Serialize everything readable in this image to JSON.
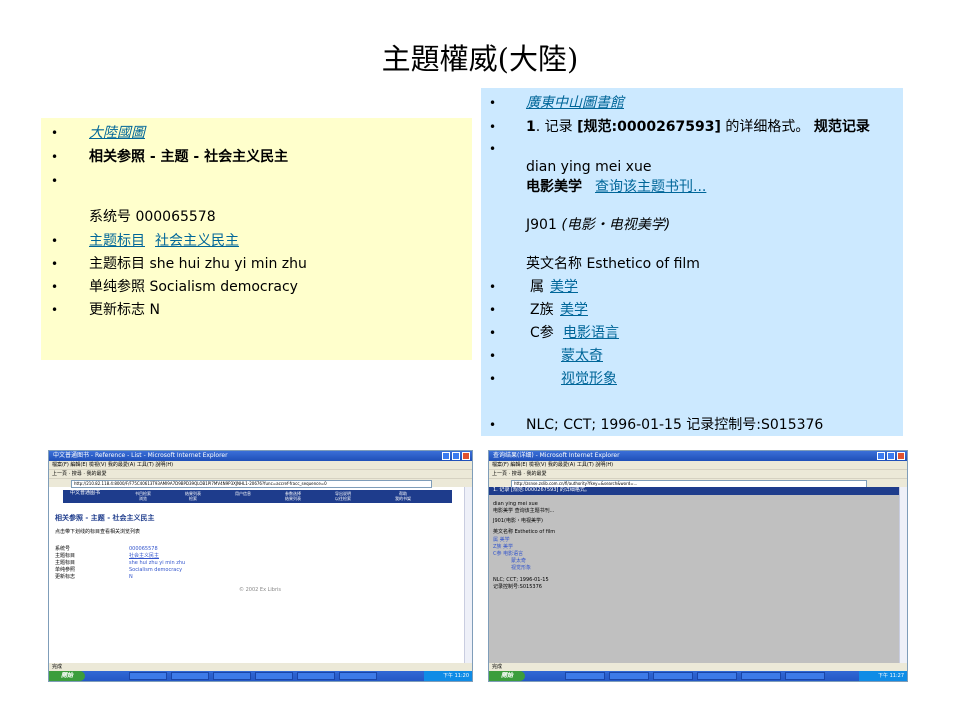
{
  "title": "主題權威(大陸)",
  "left_box": {
    "items": [
      {
        "text": "大陸國圖"
      },
      {
        "text": "相关参照 - 主题 - 社会主义民主"
      },
      {
        "text": ""
      },
      {
        "text": "系统号 000065578"
      },
      {
        "label": "主题标目",
        "link": "社会主义民主"
      },
      {
        "text": "主题标目 she hui zhu yi min zhu"
      },
      {
        "text": "单纯参照 Socialism democracy"
      },
      {
        "text": "更新标志 N"
      }
    ]
  },
  "right_box": {
    "items": [
      {
        "text": "廣東中山圖書館"
      },
      {
        "num": "1",
        "pre": ". 记录 ",
        "id": "[规范:0000267593]",
        "mid": " 的详细格式。 ",
        "tail": "规范记录"
      },
      {
        "text": ""
      },
      {
        "text": "dian ying mei xue"
      },
      {
        "label": "电影美学",
        "link": "查询该主题书刊..."
      },
      {
        "code": "J901",
        "class": "(电影・电视美学)"
      },
      {
        "text": "英文名称 Esthetico of film"
      },
      {
        "label": "属",
        "link": "美学"
      },
      {
        "label": "Z族",
        "link": "美学"
      },
      {
        "label": "C参",
        "link": "电影语言"
      },
      {
        "link": "蒙太奇"
      },
      {
        "link": "视觉形象"
      },
      {
        "text": "NLC; CCT; 1996-01-15 记录控制号:S015376"
      }
    ]
  },
  "screenshot_left": {
    "window_title": "中文普通图书 - Reference - List - Microsoft Internet Explorer",
    "menu": "檔案(F)  編輯(E)  檢視(V)  我的最愛(A)  工具(T)  說明(H)",
    "toolbar": "上一頁 · 搜尋 · 我的最愛",
    "address": "http://210.82.118.4:8000/F/F75C40613T93AMI9A7D9BPD39QLOB1PI7MV4N9P3XJNHL1-20676?func=accref-fracc_sequence=0",
    "nav_tabs": [
      "中文普通图书",
      "书目检索",
      "结果列表",
      "用户信息",
      "参数选择",
      "导出说明",
      "帮助",
      "浏览",
      "检索",
      "结果列表",
      "以往检索",
      "我的书架"
    ],
    "heading": "相关参照 - 主题 - 社会主义民主",
    "subheading": "点击带下划线的标目查看相关浏览列表",
    "rows": [
      {
        "label": "系统号",
        "value": "000065578"
      },
      {
        "label": "主题标目",
        "value": "社会主义民主"
      },
      {
        "label": "主题标目",
        "value": "she hui zhu yi min zhu"
      },
      {
        "label": "单纯参照",
        "value": "Socialism democracy"
      },
      {
        "label": "更新标志",
        "value": "N"
      }
    ],
    "footer": "© 2002 Ex Libris",
    "status": "完成",
    "start": "開始",
    "tray_time": "下午 11:20"
  },
  "screenshot_right": {
    "window_title": "查询结果(详细) - Microsoft Internet Explorer",
    "menu": "檔案(F)  編輯(E)  檢視(V)  我的最愛(A)  工具(T)  說明(H)",
    "toolbar": "上一頁 · 搜尋 · 我的最愛",
    "address": "http://zsnse.zslib.com.cn/fl/authority?fkey=&search&word=...",
    "header_text": "1. 记录 [规范:0000267593] 的详细格式。",
    "lines": [
      "dian ying mei xue",
      "电影美学 查询该主题书刊...",
      "J901(电影・电视美学)",
      "英文名称 Esthetico of film",
      "属 美学",
      "Z族 美学",
      "C参 电影语言",
      "蒙太奇",
      "视觉形象",
      "NLC; CCT; 1996-01-15",
      "记录控制号:S015376"
    ],
    "status": "完成",
    "start": "開始",
    "tray_time": "下午 11:27"
  },
  "colors": {
    "left_bg": "#ffffcc",
    "right_bg": "#cce9ff",
    "link": "#006699"
  }
}
